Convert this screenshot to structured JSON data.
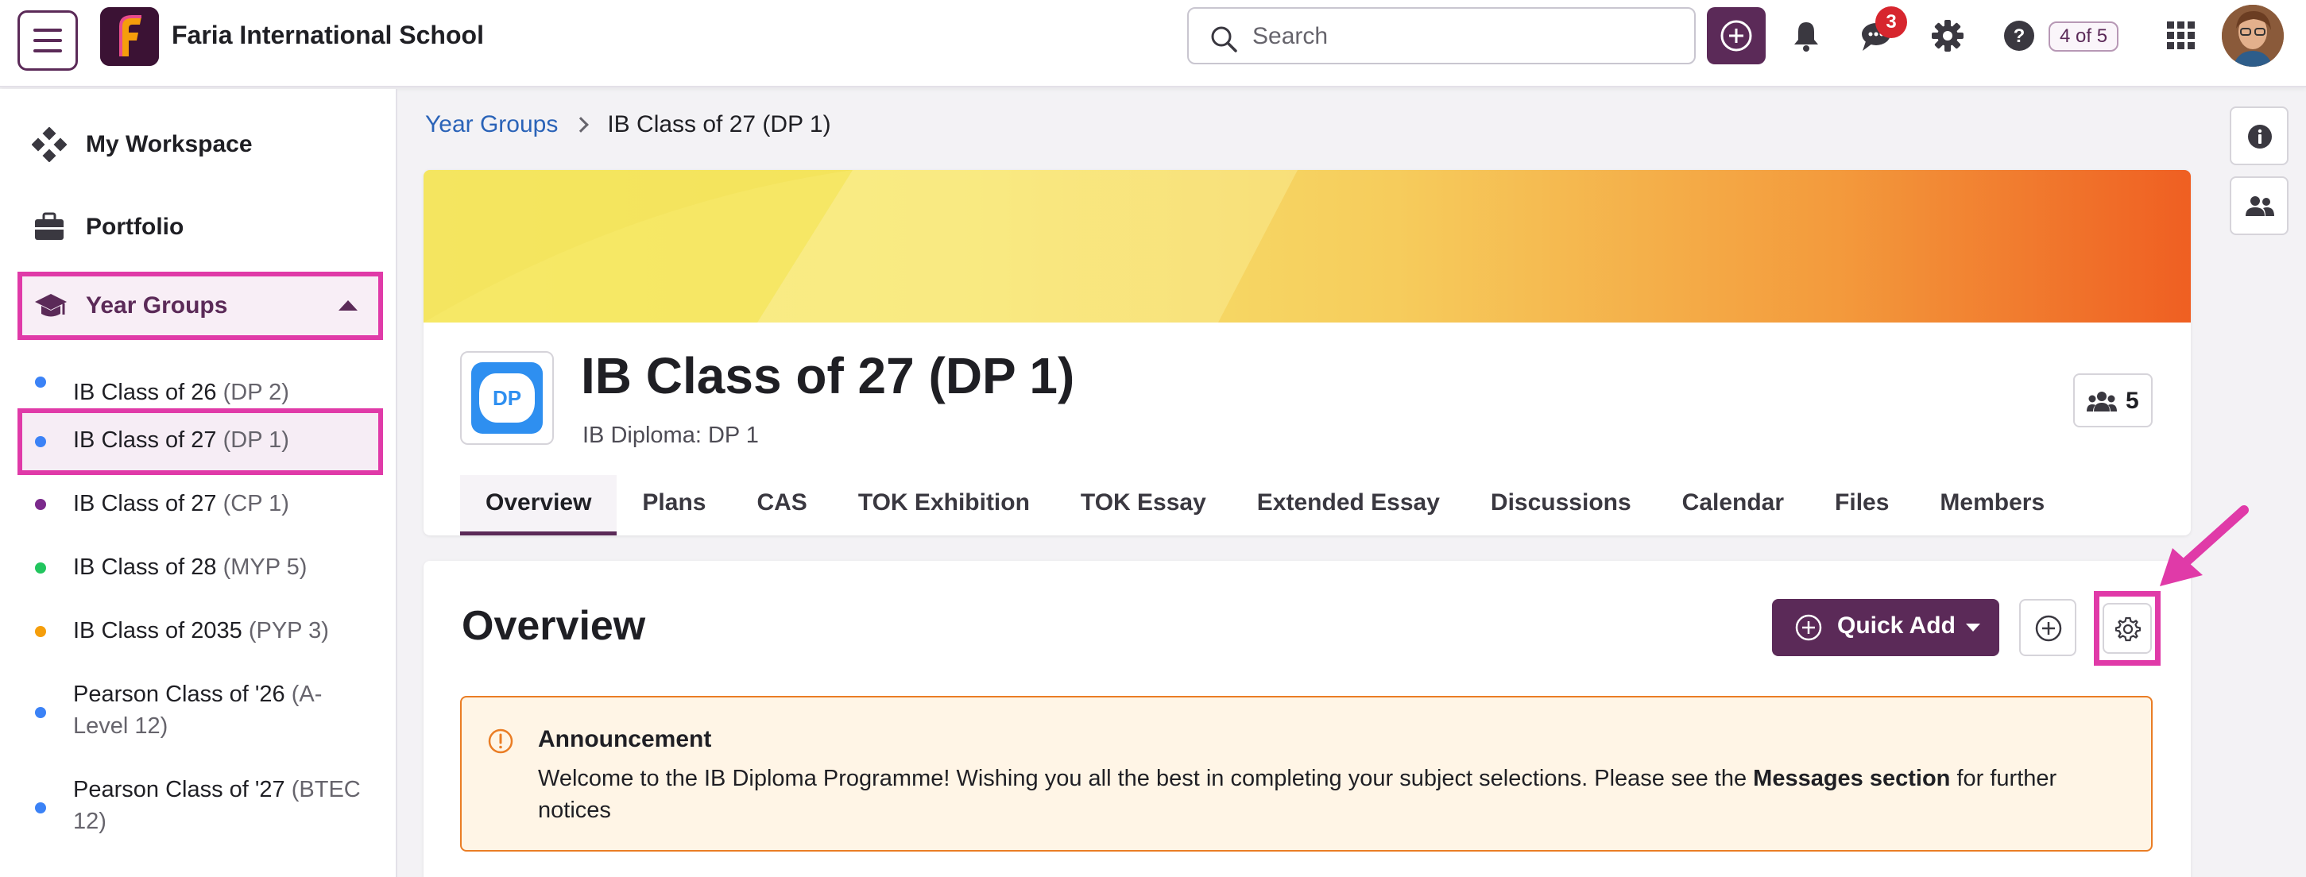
{
  "header": {
    "school_name": "Faria International School",
    "search_placeholder": "Search",
    "messages_badge": "3",
    "page_indicator": "4 of 5",
    "brand_color": "#5b2a58",
    "badge_color": "#d7262e"
  },
  "sidebar": {
    "items": [
      {
        "label": "My Workspace",
        "icon": "workspace-icon"
      },
      {
        "label": "Portfolio",
        "icon": "briefcase-icon"
      },
      {
        "label": "Year Groups",
        "icon": "graduation-cap-icon",
        "expanded": true
      }
    ],
    "year_groups": [
      {
        "name": "IB Class of 26 ",
        "code": "(DP 2)",
        "dot_color": "#3b82f6"
      },
      {
        "name": "IB Class of 27 ",
        "code": "(DP 1)",
        "dot_color": "#3b82f6",
        "active": true
      },
      {
        "name": "IB Class of 27 ",
        "code": "(CP 1)",
        "dot_color": "#7b2a8c"
      },
      {
        "name": "IB Class of 28 ",
        "code": "(MYP 5)",
        "dot_color": "#22c55e"
      },
      {
        "name": "IB Class of 2035 ",
        "code": "(PYP 3)",
        "dot_color": "#f59e0b"
      },
      {
        "name": "Pearson Class of '26 ",
        "code": "(A-Level 12)",
        "dot_color": "#3b82f6"
      },
      {
        "name": "Pearson Class of '27 ",
        "code": "(BTEC 12)",
        "dot_color": "#3b82f6"
      }
    ]
  },
  "breadcrumb": {
    "parent": "Year Groups",
    "current": "IB Class of 27 (DP 1)"
  },
  "class_header": {
    "logo_text": "DP",
    "title": "IB Class of 27 (DP 1)",
    "subtitle": "IB Diploma: DP 1",
    "member_count": "5"
  },
  "tabs": [
    {
      "label": "Overview",
      "active": true
    },
    {
      "label": "Plans"
    },
    {
      "label": "CAS"
    },
    {
      "label": "TOK Exhibition"
    },
    {
      "label": "TOK Essay"
    },
    {
      "label": "Extended Essay"
    },
    {
      "label": "Discussions"
    },
    {
      "label": "Calendar"
    },
    {
      "label": "Files"
    },
    {
      "label": "Members"
    }
  ],
  "overview": {
    "title": "Overview",
    "quick_add_label": "Quick Add",
    "announcement": {
      "heading": "Announcement",
      "text_before": "Welcome to the IB Diploma Programme! Wishing you all the best in completing your subject selections. Please see the ",
      "text_bold": "Messages section",
      "text_after": " for further notices"
    }
  },
  "highlight_color": "#e03aa8"
}
